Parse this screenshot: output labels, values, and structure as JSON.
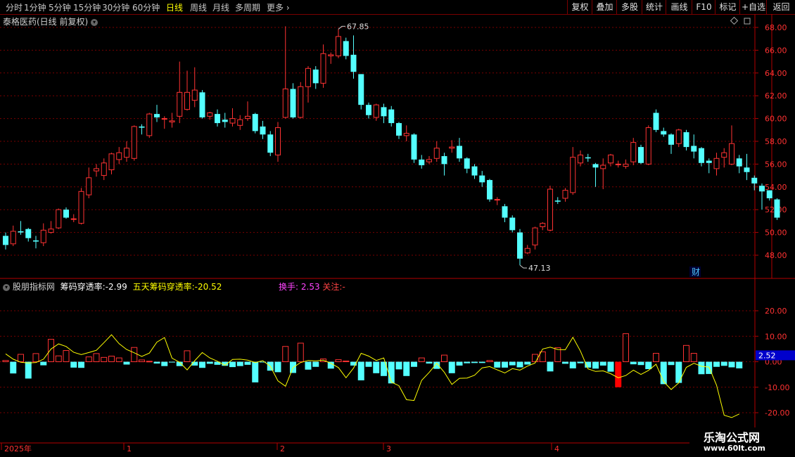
{
  "toolbar": {
    "timeframes": [
      "分时",
      "1分钟",
      "5分钟",
      "15分钟",
      "30分钟",
      "60分钟",
      "日线",
      "周线",
      "月线",
      "多周期",
      "更多"
    ],
    "active": "日线",
    "right_buttons": [
      "复权",
      "叠加",
      "多股",
      "统计",
      "画线",
      "F10",
      "标记",
      "+自选",
      "返回"
    ]
  },
  "title": {
    "stock": "泰格医药(日线 前复权)",
    "indicator_source": "股朋指标网",
    "ind1_label": "筹码穿透率:",
    "ind1_value": "-2.99",
    "ind2_label": "五天筹码穿透率:",
    "ind2_value": "-20.52",
    "turnover_label": "换手:",
    "turnover_value": "2.53",
    "attention_label": "关注:",
    "attention_value": "-"
  },
  "price_axis": [
    "68.00",
    "66.00",
    "64.00",
    "62.00",
    "60.00",
    "58.00",
    "56.00",
    "54.00",
    "52.00",
    "50.00",
    "48.00"
  ],
  "ind_axis": [
    "20.00",
    "10.00",
    "0.00",
    "-10.00",
    "-20.00"
  ],
  "ind_current": "2.52",
  "annotations": {
    "high": "67.85",
    "low": "47.13",
    "fin": "财"
  },
  "time_axis": [
    "2025年",
    "1",
    "2",
    "3",
    "4"
  ],
  "watermark": {
    "line1": "乐淘公式网",
    "line2": "www.60lt.com"
  },
  "colors": {
    "up": "#ff3232",
    "down": "#54ffff",
    "line": "#ffff00",
    "grid": "#7a0000",
    "axis": "#b40000"
  },
  "chart_data": {
    "type": "candlestick",
    "price_range": [
      46.3,
      69.2
    ],
    "indicator_range": [
      -23,
      28
    ],
    "candles": [
      [
        49.7,
        48.9,
        50.0,
        48.5
      ],
      [
        49.0,
        50.1,
        50.6,
        48.8
      ],
      [
        50.1,
        50.0,
        51.0,
        49.8
      ],
      [
        50.3,
        49.5,
        50.4,
        49.2
      ],
      [
        49.3,
        49.2,
        49.7,
        48.6
      ],
      [
        49.1,
        50.2,
        50.8,
        48.8
      ],
      [
        50.0,
        50.3,
        51.0,
        49.9
      ],
      [
        50.4,
        52.0,
        52.1,
        50.3
      ],
      [
        52.0,
        51.3,
        52.2,
        51.2
      ],
      [
        51.2,
        51.2,
        51.6,
        50.9
      ],
      [
        50.8,
        53.6,
        53.9,
        50.7
      ],
      [
        53.3,
        54.8,
        55.7,
        53.0
      ],
      [
        55.4,
        55.6,
        56.0,
        54.9
      ],
      [
        55.0,
        56.1,
        56.5,
        54.6
      ],
      [
        55.5,
        56.9,
        57.0,
        55.1
      ],
      [
        56.4,
        57.0,
        57.5,
        56.0
      ],
      [
        56.6,
        57.4,
        58.0,
        56.2
      ],
      [
        56.5,
        59.3,
        59.4,
        56.3
      ],
      [
        59.3,
        59.2,
        59.5,
        58.6
      ],
      [
        58.5,
        60.4,
        60.5,
        58.3
      ],
      [
        60.4,
        60.1,
        61.2,
        59.7
      ],
      [
        60.0,
        60.0,
        60.2,
        59.1
      ],
      [
        59.7,
        59.8,
        60.5,
        59.2
      ],
      [
        60.2,
        62.3,
        65.0,
        59.6
      ],
      [
        60.8,
        62.3,
        64.2,
        60.7
      ],
      [
        61.6,
        62.5,
        64.5,
        61.0
      ],
      [
        62.3,
        60.1,
        62.5,
        60.0
      ],
      [
        60.2,
        60.5,
        60.6,
        59.9
      ],
      [
        60.4,
        59.6,
        60.8,
        59.3
      ],
      [
        59.9,
        59.7,
        60.5,
        59.2
      ],
      [
        59.6,
        60.0,
        60.9,
        59.3
      ],
      [
        59.4,
        59.9,
        60.3,
        59.0
      ],
      [
        60.0,
        60.2,
        61.5,
        59.8
      ],
      [
        60.4,
        58.9,
        60.5,
        58.7
      ],
      [
        59.3,
        58.6,
        59.8,
        58.2
      ],
      [
        58.6,
        57.0,
        58.9,
        56.7
      ],
      [
        56.8,
        59.2,
        59.7,
        56.2
      ],
      [
        60.1,
        62.6,
        68.1,
        60.0
      ],
      [
        62.6,
        60.1,
        63.1,
        60.0
      ],
      [
        60.1,
        62.8,
        63.2,
        60.0
      ],
      [
        62.8,
        64.4,
        64.6,
        61.4
      ],
      [
        64.3,
        63.1,
        64.6,
        62.6
      ],
      [
        63.1,
        65.7,
        66.5,
        62.7
      ],
      [
        65.5,
        65.6,
        65.8,
        64.8
      ],
      [
        65.5,
        67.2,
        67.85,
        65.3
      ],
      [
        66.8,
        65.5,
        67.1,
        65.2
      ],
      [
        65.6,
        64.1,
        67.3,
        63.5
      ],
      [
        63.9,
        61.2,
        63.9,
        60.8
      ],
      [
        61.2,
        60.3,
        61.4,
        60.0
      ],
      [
        60.1,
        61.2,
        61.3,
        59.8
      ],
      [
        61.0,
        60.2,
        61.3,
        59.6
      ],
      [
        60.8,
        59.6,
        61.1,
        59.3
      ],
      [
        59.6,
        58.5,
        59.7,
        58.2
      ],
      [
        58.5,
        58.7,
        59.4,
        58.0
      ],
      [
        58.6,
        56.4,
        58.7,
        56.1
      ],
      [
        56.4,
        55.9,
        56.8,
        55.6
      ],
      [
        56.2,
        56.4,
        56.7,
        56.0
      ],
      [
        56.5,
        57.4,
        58.0,
        56.2
      ],
      [
        56.7,
        56.0,
        57.0,
        55.0
      ],
      [
        57.4,
        57.5,
        58.1,
        57.0
      ],
      [
        57.6,
        56.5,
        58.3,
        56.2
      ],
      [
        56.5,
        55.6,
        56.6,
        55.2
      ],
      [
        55.8,
        55.0,
        56.0,
        54.7
      ],
      [
        55.0,
        54.4,
        55.4,
        54.0
      ],
      [
        54.6,
        52.9,
        54.7,
        52.7
      ],
      [
        52.9,
        52.9,
        53.1,
        52.4
      ],
      [
        52.3,
        51.3,
        52.5,
        50.9
      ],
      [
        51.3,
        50.2,
        51.5,
        50.0
      ],
      [
        50.0,
        47.7,
        50.3,
        47.13
      ],
      [
        48.2,
        48.6,
        48.9,
        48.1
      ],
      [
        48.9,
        50.4,
        50.5,
        48.5
      ],
      [
        50.5,
        50.8,
        50.9,
        50.2
      ],
      [
        50.2,
        53.8,
        54.1,
        50.1
      ],
      [
        52.8,
        52.7,
        53.1,
        52.5
      ],
      [
        53.0,
        53.7,
        53.9,
        52.7
      ],
      [
        53.5,
        56.6,
        57.5,
        53.3
      ],
      [
        56.1,
        56.8,
        57.2,
        55.8
      ],
      [
        56.6,
        56.5,
        56.9,
        56.2
      ],
      [
        56.0,
        55.7,
        56.1,
        54.0
      ],
      [
        55.6,
        55.9,
        56.5,
        53.8
      ],
      [
        56.1,
        56.8,
        56.9,
        55.8
      ],
      [
        56.0,
        56.0,
        56.3,
        55.7
      ],
      [
        55.8,
        56.0,
        56.4,
        55.6
      ],
      [
        56.2,
        57.9,
        58.3,
        55.9
      ],
      [
        57.5,
        56.1,
        57.7,
        56.0
      ],
      [
        56.0,
        59.2,
        59.4,
        55.9
      ],
      [
        60.5,
        59.0,
        60.8,
        58.8
      ],
      [
        58.9,
        58.6,
        59.2,
        58.4
      ],
      [
        58.6,
        57.7,
        58.7,
        56.9
      ],
      [
        57.8,
        59.0,
        59.1,
        57.5
      ],
      [
        58.8,
        57.5,
        59.0,
        57.2
      ],
      [
        57.6,
        57.1,
        58.6,
        56.5
      ],
      [
        57.4,
        56.1,
        57.5,
        55.8
      ],
      [
        56.3,
        56.1,
        56.5,
        55.2
      ],
      [
        55.6,
        56.5,
        57.0,
        55.0
      ],
      [
        56.6,
        57.0,
        57.4,
        55.7
      ],
      [
        56.0,
        57.8,
        59.4,
        55.9
      ],
      [
        56.5,
        55.8,
        56.8,
        55.2
      ],
      [
        55.7,
        55.3,
        56.9,
        54.6
      ],
      [
        54.8,
        54.3,
        55.0,
        53.7
      ],
      [
        54.1,
        53.6,
        54.3,
        52.0
      ],
      [
        53.7,
        53.0,
        53.7,
        52.8
      ],
      [
        52.9,
        51.3,
        53.0,
        51.1
      ]
    ],
    "ind_bars": [
      0.5,
      -4.6,
      2.9,
      -6.6,
      3.2,
      -1.4,
      8.8,
      2.3,
      4.4,
      -2.3,
      -2.4,
      1.9,
      3.2,
      1.7,
      2.2,
      1.5,
      -1.1,
      5.6,
      0.7,
      0.2,
      -0.7,
      -1.7,
      -0.3,
      -1.7,
      4.3,
      -1.5,
      -2.4,
      -0.8,
      -1.2,
      -1.6,
      -2.1,
      -1.7,
      -1.2,
      -8.1,
      -0.2,
      -3.5,
      -4.1,
      6.0,
      -4.4,
      7.3,
      -3.1,
      -2.0,
      1.1,
      -2.7,
      0.8,
      0.3,
      -1.5,
      -7.3,
      -2.0,
      -4.5,
      -5.6,
      -8.5,
      -3.0,
      -5.6,
      -2.0,
      1.5,
      -0.7,
      -2.8,
      2.6,
      -4.5,
      -1.5,
      -0.6,
      -0.5,
      -0.5,
      0.5,
      -2.3,
      -2.3,
      -1.4,
      -2.2,
      -1.1,
      2.9,
      3.9,
      -3.8,
      5.5,
      -0.8,
      -2.6,
      -0.6,
      -2.3,
      -2.7,
      -1.5,
      -3.9,
      -10.0,
      11.0,
      -1.0,
      -1.3,
      -2.9,
      3.3,
      -8.8,
      -1.3,
      -8.3,
      6.4,
      3.3,
      -4.9,
      -4.8,
      -2.0,
      -1.6,
      -2.2,
      -2.6
    ],
    "ind_line": [
      3.1,
      1.0,
      -0.2,
      -0.5,
      -0.3,
      1.0,
      5.0,
      7.0,
      6.0,
      3.7,
      2.8,
      3.6,
      4.5,
      7.5,
      10.6,
      7.1,
      4.8,
      3.5,
      2.1,
      3.4,
      7.7,
      9.5,
      1.4,
      -0.2,
      -3.2,
      0.4,
      3.6,
      1.5,
      0.2,
      -1.4,
      0.9,
      1.0,
      0.6,
      -0.3,
      0.4,
      -1.8,
      -7.5,
      -9.6,
      -2.3,
      -0.3,
      0.5,
      0.3,
      0.6,
      -0.6,
      -2.3,
      -6.3,
      -2.5,
      3.3,
      2.2,
      0.5,
      1.5,
      -8.0,
      -9.4,
      -14.9,
      -15.2,
      -7.3,
      -4.2,
      -0.6,
      -4.1,
      -8.9,
      -6.5,
      -6.4,
      -5.3,
      -2.4,
      -1.9,
      -3.2,
      -4.4,
      -2.7,
      -3.3,
      -1.7,
      -0.5,
      5.0,
      5.7,
      4.8,
      4.7,
      9.6,
      4.2,
      -2.8,
      -3.8,
      -3.6,
      -4.7,
      -6.3,
      -5.4,
      -3.3,
      -5.0,
      -3.4,
      -1.0,
      -7.8,
      -10.9,
      -8.3,
      -2.2,
      -0.6,
      -1.8,
      -2.1,
      -9.2,
      -21.0,
      -21.9,
      -20.5
    ]
  }
}
